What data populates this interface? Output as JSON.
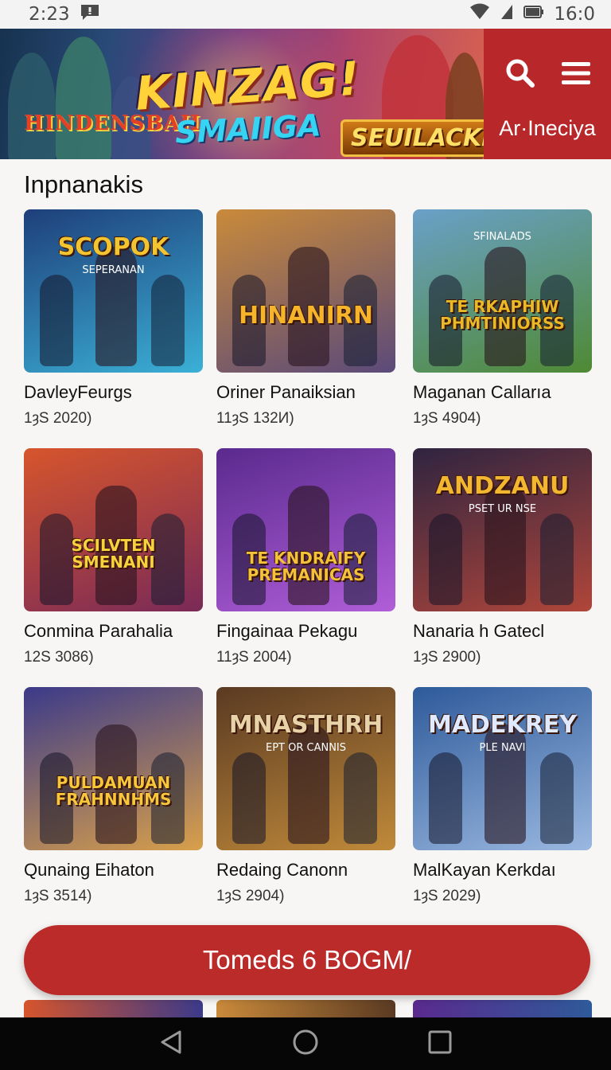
{
  "status_bar": {
    "time": "2:23",
    "clock": "16:0"
  },
  "banner": {
    "title": "KINZAG!",
    "subtitle": "SMAIIGA",
    "left_logo": "HINDENSBAH",
    "badge": "SEUILACKI!"
  },
  "header_panel": {
    "label": "Ar·Ineciya"
  },
  "section": {
    "title": "Inpnanakis"
  },
  "games": [
    {
      "title": "DavleyFeurgs",
      "meta": "1ȝS 2020)",
      "art_text": "SCOPOK",
      "art_sub": "SEPERANAN",
      "color_a": "#1e3f7a",
      "color_b": "#3bb0d6",
      "text_color": "#f2c431"
    },
    {
      "title": "Oriner Panaiksian",
      "meta": "11ȝS 132И)",
      "art_text": "HINANIRN",
      "art_sub": "",
      "color_a": "#c98a3a",
      "color_b": "#5b4a7a",
      "text_color": "#f6b42b"
    },
    {
      "title": "Maganan Callarıa",
      "meta": "1ȝS 4904)",
      "art_text": "TE RKAPHIW PHMTINIORSS",
      "art_sub": "SFINALADS",
      "color_a": "#6aa0c8",
      "color_b": "#4f8a34",
      "text_color": "#e9b928"
    },
    {
      "title": "Conmina Parahalia",
      "meta": "12S 3086)",
      "art_text": "SCILVTEN SMENANI",
      "art_sub": "",
      "color_a": "#d6552c",
      "color_b": "#7a2a58",
      "text_color": "#f7d23c"
    },
    {
      "title": "Fingainaa Pekagu",
      "meta": "11ȝS 2004)",
      "art_text": "TE KNDRAIFY PREMANICAS",
      "art_sub": "",
      "color_a": "#5a2a8e",
      "color_b": "#b05ed8",
      "text_color": "#f3c13a"
    },
    {
      "title": "Nanaria h Gatecl",
      "meta": "1ȝS 2900)",
      "art_text": "ANDZANU",
      "art_sub": "PSET UR NSE",
      "color_a": "#2f2440",
      "color_b": "#b0463a",
      "text_color": "#f2b630"
    },
    {
      "title": "Qunaing Eihaton",
      "meta": "1ȝS 3514)",
      "art_text": "PULDAMUAN FRAHNNHMS",
      "art_sub": "",
      "color_a": "#3b3a8a",
      "color_b": "#d9a04a",
      "text_color": "#f7c63b"
    },
    {
      "title": "Redaing Canonn",
      "meta": "1ȝS 2904)",
      "art_text": "MNASTHRH",
      "art_sub": "EPT OR CANNIS",
      "color_a": "#5a3a22",
      "color_b": "#c08a3a",
      "text_color": "#e8d2a8"
    },
    {
      "title": "MalKayan Kerkdaı",
      "meta": "1ȝS 2029)",
      "art_text": "MADEKREY",
      "art_sub": "PLE NAVI",
      "color_a": "#2e5a9a",
      "color_b": "#9ab8e0",
      "text_color": "#dfe9ff"
    }
  ],
  "cta": {
    "label": "Tomeds 6 BOGM/"
  }
}
